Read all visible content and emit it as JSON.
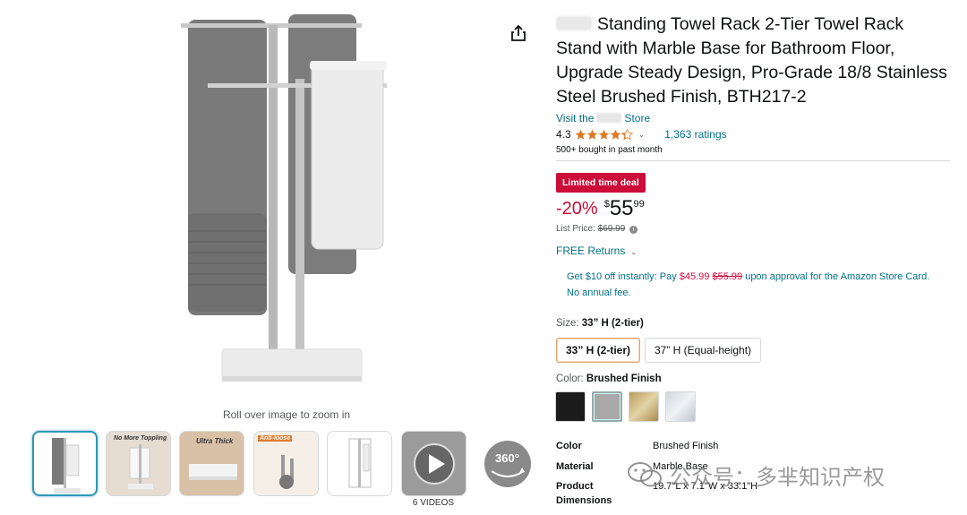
{
  "gallery": {
    "zoom_hint": "Roll over image to zoom in",
    "videos_label": "6 VIDEOS",
    "thumbs": [
      {
        "caption": ""
      },
      {
        "caption": "No More Toppling"
      },
      {
        "caption": "Ultra Thick"
      },
      {
        "caption": "Anti-loose"
      },
      {
        "caption": ""
      },
      {
        "caption": ""
      },
      {
        "caption": "360°"
      }
    ]
  },
  "product": {
    "title": "Standing Towel Rack 2-Tier Towel Rack Stand with Marble Base for Bathroom Floor, Upgrade Steady Design, Pro-Grade 18/8 Stainless Steel Brushed Finish, BTH217-2",
    "store_prefix": "Visit the",
    "store_suffix": "Store",
    "rating": "4.3",
    "ratings_count": "1,363 ratings",
    "bought": "500+ bought in past month"
  },
  "pricing": {
    "deal_badge": "Limited time deal",
    "discount": "-20%",
    "currency": "$",
    "whole": "55",
    "fraction": "99",
    "list_price_label": "List Price:",
    "list_price": "$69.99",
    "free_returns": "FREE Returns",
    "card_offer_1": "Get $10 off instantly: Pay ",
    "card_offer_new": "$45.99",
    "card_offer_old": "$55.99",
    "card_offer_2": " upon approval for the Amazon Store Card.",
    "card_offer_3": "No annual fee."
  },
  "options": {
    "size_label": "Size:",
    "size_selected": "33” H (2-tier)",
    "sizes": [
      "33” H (2-tier)",
      "37” H (Equal-height)"
    ],
    "color_label": "Color:",
    "color_selected": "Brushed Finish",
    "swatch_colors": [
      "#1c1c1c",
      "#a9a9a9",
      "#c9b27c",
      "#d8dde3"
    ]
  },
  "specs": [
    {
      "key": "Color",
      "value": "Brushed Finish"
    },
    {
      "key": "Material",
      "value": "Marble Base"
    },
    {
      "key": "Product Dimensions",
      "value": "19.7\"L x 7.1\"W x 33.1\"H"
    }
  ],
  "watermark": "公众号：多芈知识产权",
  "colors": {
    "link": "#007185",
    "deal": "#cc0c39",
    "accent_border": "#2a9ab4"
  }
}
